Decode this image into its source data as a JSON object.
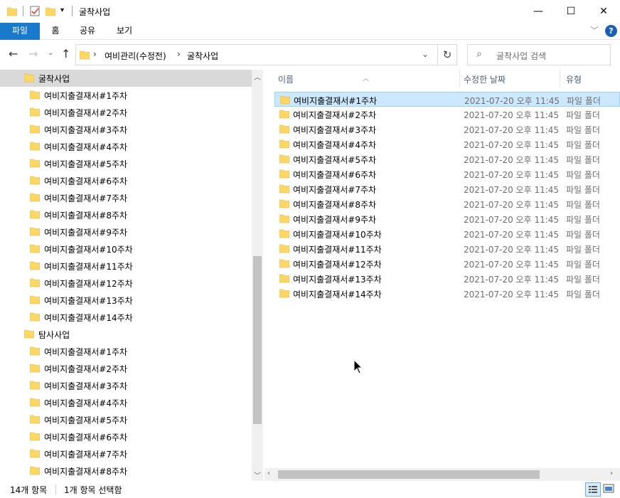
{
  "window": {
    "title": "굴착사업",
    "minimize": "—",
    "maximize": "☐",
    "close": "✕"
  },
  "ribbon": {
    "tabs": [
      "파일",
      "홈",
      "공유",
      "보기"
    ],
    "help": "?"
  },
  "address": {
    "crumbs": [
      "여비관리(수정전)",
      "굴착사업"
    ],
    "search_placeholder": "굴착사업 검색"
  },
  "nav_tree": [
    {
      "label": "굴착사업",
      "level": 0,
      "selected": true
    },
    {
      "label": "여비지출결재서#1주차",
      "level": 1
    },
    {
      "label": "여비지출결재서#2주차",
      "level": 1
    },
    {
      "label": "여비지출결재서#3주차",
      "level": 1
    },
    {
      "label": "여비지출결재서#4주차",
      "level": 1
    },
    {
      "label": "여비지출결재서#5주차",
      "level": 1
    },
    {
      "label": "여비지출결재서#6주차",
      "level": 1
    },
    {
      "label": "여비지출결재서#7주차",
      "level": 1
    },
    {
      "label": "여비지출결재서#8주차",
      "level": 1
    },
    {
      "label": "여비지출결재서#9주차",
      "level": 1
    },
    {
      "label": "여비지출결재서#10주차",
      "level": 1
    },
    {
      "label": "여비지출결재서#11주차",
      "level": 1
    },
    {
      "label": "여비지출결재서#12주차",
      "level": 1
    },
    {
      "label": "여비지출결재서#13주차",
      "level": 1
    },
    {
      "label": "여비지출결재서#14주차",
      "level": 1
    },
    {
      "label": "탐사사업",
      "level": 0
    },
    {
      "label": "여비지출결재서#1주차",
      "level": 1
    },
    {
      "label": "여비지출결재서#2주차",
      "level": 1
    },
    {
      "label": "여비지출결재서#3주차",
      "level": 1
    },
    {
      "label": "여비지출결재서#4주차",
      "level": 1
    },
    {
      "label": "여비지출결재서#5주차",
      "level": 1
    },
    {
      "label": "여비지출결재서#6주차",
      "level": 1
    },
    {
      "label": "여비지출결재서#7주차",
      "level": 1
    },
    {
      "label": "여비지출결재서#8주차",
      "level": 1
    }
  ],
  "columns": {
    "name": "이름",
    "date": "수정한 날짜",
    "type": "유형"
  },
  "files": [
    {
      "name": "여비지출결재서#1주차",
      "date": "2021-07-20 오후 11:45",
      "type": "파일 폴더",
      "selected": true
    },
    {
      "name": "여비지출결재서#2주차",
      "date": "2021-07-20 오후 11:45",
      "type": "파일 폴더"
    },
    {
      "name": "여비지출결재서#3주차",
      "date": "2021-07-20 오후 11:45",
      "type": "파일 폴더"
    },
    {
      "name": "여비지출결재서#4주차",
      "date": "2021-07-20 오후 11:45",
      "type": "파일 폴더"
    },
    {
      "name": "여비지출결재서#5주차",
      "date": "2021-07-20 오후 11:45",
      "type": "파일 폴더"
    },
    {
      "name": "여비지출결재서#6주차",
      "date": "2021-07-20 오후 11:45",
      "type": "파일 폴더"
    },
    {
      "name": "여비지출결재서#7주차",
      "date": "2021-07-20 오후 11:45",
      "type": "파일 폴더"
    },
    {
      "name": "여비지출결재서#8주차",
      "date": "2021-07-20 오후 11:45",
      "type": "파일 폴더"
    },
    {
      "name": "여비지출결재서#9주차",
      "date": "2021-07-20 오후 11:45",
      "type": "파일 폴더"
    },
    {
      "name": "여비지출결재서#10주차",
      "date": "2021-07-20 오후 11:45",
      "type": "파일 폴더"
    },
    {
      "name": "여비지출결재서#11주차",
      "date": "2021-07-20 오후 11:45",
      "type": "파일 폴더"
    },
    {
      "name": "여비지출결재서#12주차",
      "date": "2021-07-20 오후 11:45",
      "type": "파일 폴더"
    },
    {
      "name": "여비지출결재서#13주차",
      "date": "2021-07-20 오후 11:45",
      "type": "파일 폴더"
    },
    {
      "name": "여비지출결재서#14주차",
      "date": "2021-07-20 오후 11:45",
      "type": "파일 폴더"
    }
  ],
  "status": {
    "item_count": "14개 항목",
    "selected_count": "1개 항목 선택함"
  },
  "colors": {
    "accent": "#1979ca",
    "folder": "#ffd766",
    "selection": "#cce8ff"
  }
}
